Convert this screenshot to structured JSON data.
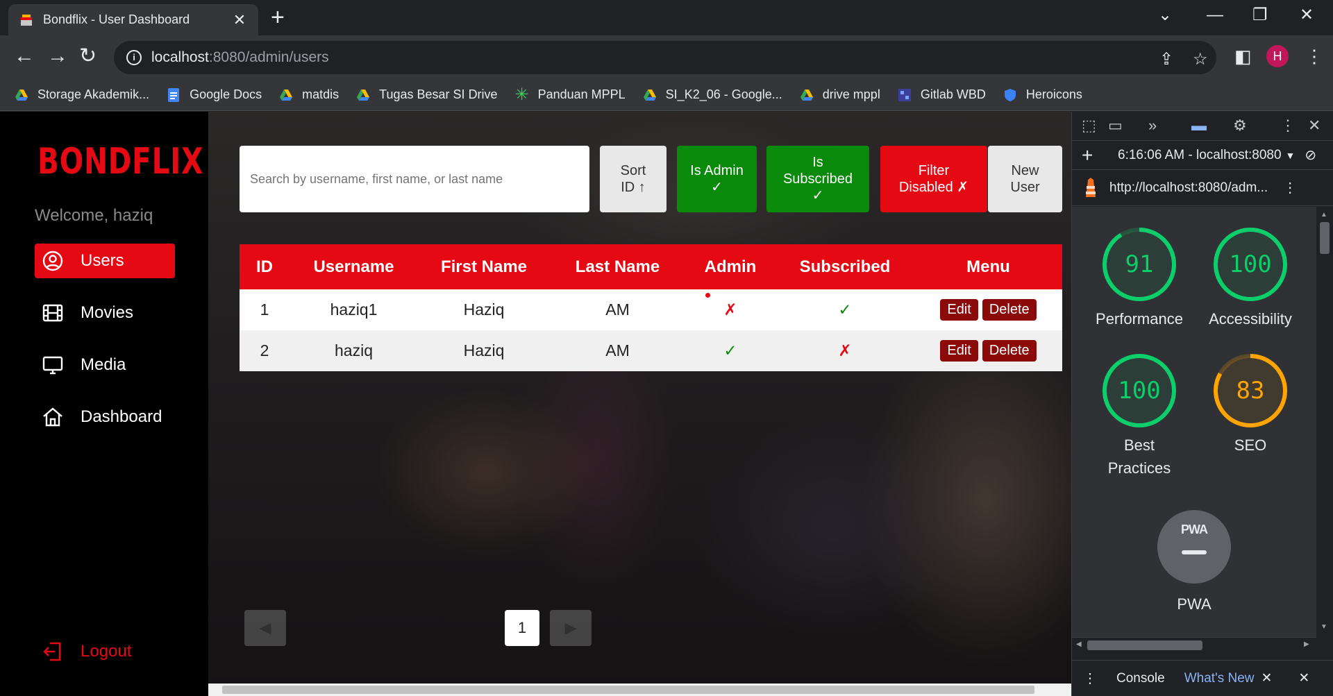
{
  "browser": {
    "tab_title": "Bondflix - User Dashboard",
    "url_host": "localhost",
    "url_path": ":8080/admin/users",
    "profile_initial": "H",
    "bookmarks": [
      {
        "label": "Storage Akademik...",
        "icon": "google-drive-icon"
      },
      {
        "label": "Google Docs",
        "icon": "google-docs-icon"
      },
      {
        "label": "matdis",
        "icon": "google-drive-icon"
      },
      {
        "label": "Tugas Besar SI Drive",
        "icon": "google-drive-icon"
      },
      {
        "label": "Panduan MPPL",
        "icon": "asterisk-icon"
      },
      {
        "label": "SI_K2_06 - Google...",
        "icon": "google-drive-icon"
      },
      {
        "label": "drive mppl",
        "icon": "google-drive-icon"
      },
      {
        "label": "Gitlab WBD",
        "icon": "gitlab-icon"
      },
      {
        "label": "Heroicons",
        "icon": "heroicons-icon"
      }
    ]
  },
  "sidebar": {
    "brand": "BONDFLIX",
    "welcome": "Welcome, haziq",
    "items": [
      {
        "label": "Users",
        "icon": "user-circle-icon",
        "active": true
      },
      {
        "label": "Movies",
        "icon": "film-icon",
        "active": false
      },
      {
        "label": "Media",
        "icon": "monitor-icon",
        "active": false
      },
      {
        "label": "Dashboard",
        "icon": "home-icon",
        "active": false
      }
    ],
    "logout": "Logout"
  },
  "toolbar": {
    "search_placeholder": "Search by username, first name, or last name",
    "sort_line1": "Sort",
    "sort_line2": "ID ↑",
    "is_admin_line1": "Is Admin",
    "is_admin_line2": "✓",
    "is_subscribed_line1": "Is",
    "is_subscribed_line2": "Subscribed",
    "is_subscribed_line3": "✓",
    "filter_line1": "Filter",
    "filter_line2": "Disabled ✗",
    "new_user_line1": "New",
    "new_user_line2": "User"
  },
  "table": {
    "headers": [
      "ID",
      "Username",
      "First Name",
      "Last Name",
      "Admin",
      "Subscribed",
      "Menu"
    ],
    "rows": [
      {
        "id": "1",
        "username": "haziq1",
        "first_name": "Haziq",
        "last_name": "AM",
        "admin": "✗",
        "subscribed": "✓"
      },
      {
        "id": "2",
        "username": "haziq",
        "first_name": "Haziq",
        "last_name": "AM",
        "admin": "✓",
        "subscribed": "✗"
      }
    ],
    "edit_label": "Edit",
    "delete_label": "Delete"
  },
  "pagination": {
    "prev": "◀",
    "current": "1",
    "next": "▶"
  },
  "devtools": {
    "report_time": "6:16:06 AM - localhost:8080",
    "report_url": "http://localhost:8080/adm...",
    "scores": [
      {
        "label": "Performance",
        "value": "91",
        "color": "#0cce6b"
      },
      {
        "label": "Accessibility",
        "value": "100",
        "color": "#0cce6b"
      },
      {
        "label": "Best Practices",
        "value": "100",
        "color": "#0cce6b"
      },
      {
        "label": "SEO",
        "value": "83",
        "color": "#ffa400"
      }
    ],
    "pwa_label": "PWA",
    "pwa_badge": "PWA",
    "drawer_console": "Console",
    "drawer_whats_new": "What's New"
  },
  "colors": {
    "brand_red": "#e50914",
    "success_green": "#0a8a0a",
    "score_good": "#0cce6b",
    "score_average": "#ffa400"
  }
}
